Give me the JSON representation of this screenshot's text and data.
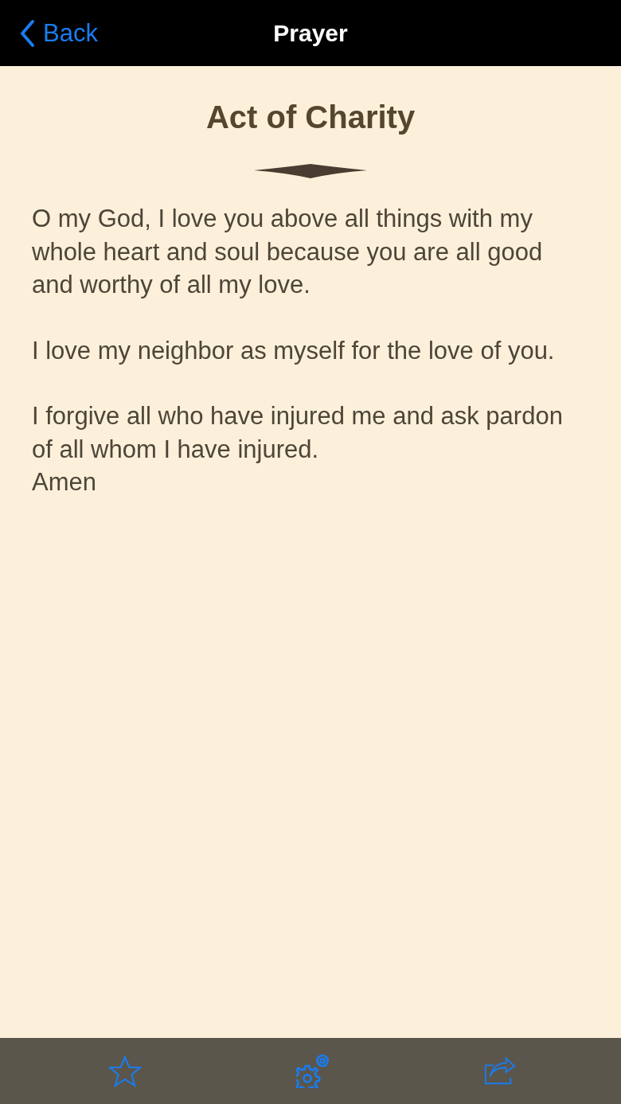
{
  "nav_bar": {
    "back": "Back",
    "title": "Prayer"
  },
  "prayer": {
    "title": "Act of Charity",
    "paragraphs": [
      "O my God, I love you above all things with my whole heart and soul because you are all good and worthy of all my love.",
      "I love my neighbor as myself for the love of you.",
      "I forgive all who have injured me and ask pardon of all whom I have injured.\nAmen"
    ]
  },
  "toolbar": [
    {
      "kind": "favorite"
    },
    {
      "kind": "settings"
    },
    {
      "kind": "share"
    }
  ]
}
